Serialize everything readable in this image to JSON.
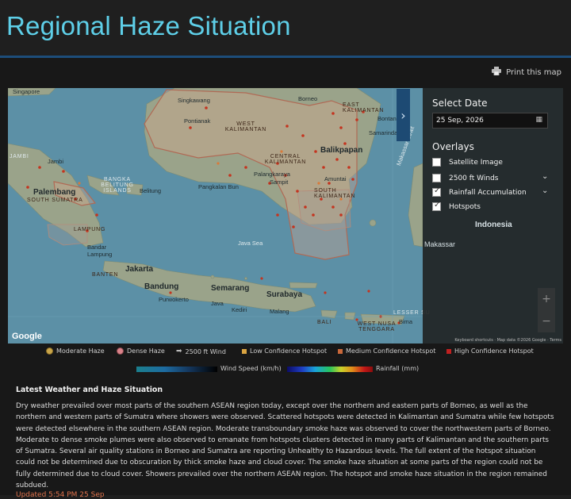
{
  "page": {
    "title": "Regional Haze Situation",
    "print_label": "Print this map"
  },
  "map": {
    "labels": {
      "singapore": "Singapore",
      "singkawang": "Singkawang",
      "pontianak": "Pontianak",
      "west_kalimantan": "WEST KALIMANTAN",
      "borneo": "Borneo",
      "east_kalimantan": "EAST KALIMANTAN",
      "bontang": "Bontang",
      "samarinda": "Samarinda",
      "balikpapan": "Balikpapan",
      "central_kalimantan": "CENTRAL KALIMANTAN",
      "palangkaraya": "Palangkaraya",
      "sampit": "Sampit",
      "amuntai": "Amuntai",
      "south_kalimantan": "SOUTH KALIMANTAN",
      "pangkalan_bun": "Pangkalan Bun",
      "jambi_region": "JAMBI",
      "jambi": "Jambi",
      "bangka": "BANGKA BELITUNG ISLANDS",
      "belitung": "Belitung",
      "palembang": "Palembang",
      "south_sumatra": "SOUTH SUMATRA",
      "lampung": "LAMPUNG",
      "bandar_lampung": "Bandar Lampung",
      "java_sea": "Java Sea",
      "jakarta": "Jakarta",
      "banten": "BANTEN",
      "bandung": "Bandung",
      "purwokerto": "Purwokerto",
      "semarang": "Semarang",
      "java": "Java",
      "kediri": "Kediri",
      "surabaya": "Surabaya",
      "malang": "Malang",
      "bali": "BALI",
      "west_nusa_tenggara": "WEST NUSA TENGGARA",
      "bima": "Bima",
      "makassar_strait": "Makassar Strait",
      "makassar": "Makassar",
      "indonesia": "Indonesia",
      "lesser": "LESSER SU"
    },
    "attribution": "Keyboard shortcuts · Map data ©2026 Google · Terms",
    "google_logo": "Google",
    "zoom_in": "+",
    "zoom_out": "−"
  },
  "sidebar": {
    "date_heading": "Select Date",
    "date_value": "25 Sep, 2026",
    "overlays_heading": "Overlays",
    "overlays": [
      {
        "label": "Satellite Image",
        "checked": false
      },
      {
        "label": "2500 ft Winds",
        "checked": false
      },
      {
        "label": "Rainfall Accumulation",
        "checked": true
      },
      {
        "label": "Hotspots",
        "checked": true
      }
    ]
  },
  "legend": {
    "items": [
      {
        "label": "Moderate Haze",
        "color": "#c9a54a"
      },
      {
        "label": "Dense Haze",
        "color": "#d9828a"
      },
      {
        "label": "2500 ft Wind",
        "color": "#bbbbbb"
      },
      {
        "label": "Low Confidence Hotspot",
        "color": "#d9a441"
      },
      {
        "label": "Medium Confidence Hotspot",
        "color": "#c9683a"
      },
      {
        "label": "High Confidence Hotspot",
        "color": "#c02020"
      }
    ],
    "wind_scale_label": "Wind Speed (km/h)",
    "rain_scale_label": "Rainfall (mm)"
  },
  "report": {
    "heading": "Latest Weather and Haze Situation",
    "body": "Dry weather prevailed over most parts of the southern ASEAN region today, except over the northern and eastern parts of Borneo, as well as the northern and western parts of Sumatra where showers were observed. Scattered hotspots were detected in Kalimantan and Sumatra while few hotspots were detected elsewhere in the southern ASEAN region. Moderate transboundary smoke haze was observed to cover the northwestern parts of Borneo. Moderate to dense smoke plumes were also observed to emanate from hotspots clusters detected in many parts of Kalimantan and the southern parts of Sumatra. Several air quality stations in Borneo and Sumatra are reporting Unhealthy to Hazardous levels. The full extent of the hotspot situation could not be determined due to obscuration by thick smoke haze and cloud cover. The smoke haze situation at some parts of the region could not be fully determined due to cloud cover. Showers prevailed over the northern ASEAN region. The hotspot and smoke haze situation in the region remained subdued.",
    "updated": "Updated 5:54 PM 25 Sep"
  }
}
